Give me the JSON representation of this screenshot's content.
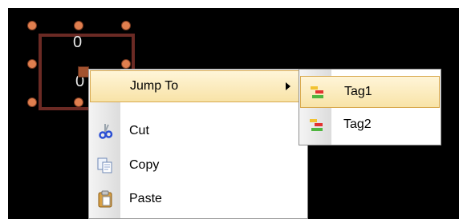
{
  "shape": {
    "label_top": "0",
    "label_bottom": "0"
  },
  "context_menu": {
    "items": [
      {
        "label": "Jump To",
        "icon": "none",
        "has_submenu": true,
        "highlighted": true
      },
      {
        "label": "Cut",
        "icon": "scissors-icon"
      },
      {
        "label": "Copy",
        "icon": "copy-icon"
      },
      {
        "label": "Paste",
        "icon": "clipboard-icon"
      }
    ]
  },
  "submenu": {
    "items": [
      {
        "label": "Tag1",
        "icon": "tag-icon",
        "highlighted": true
      },
      {
        "label": "Tag2",
        "icon": "tag-icon"
      }
    ]
  },
  "colors": {
    "canvas_background": "#000000",
    "shape_border": "#6b2a24",
    "handle_fill": "#e07f4f",
    "menu_highlight": "#f8e3a7"
  }
}
